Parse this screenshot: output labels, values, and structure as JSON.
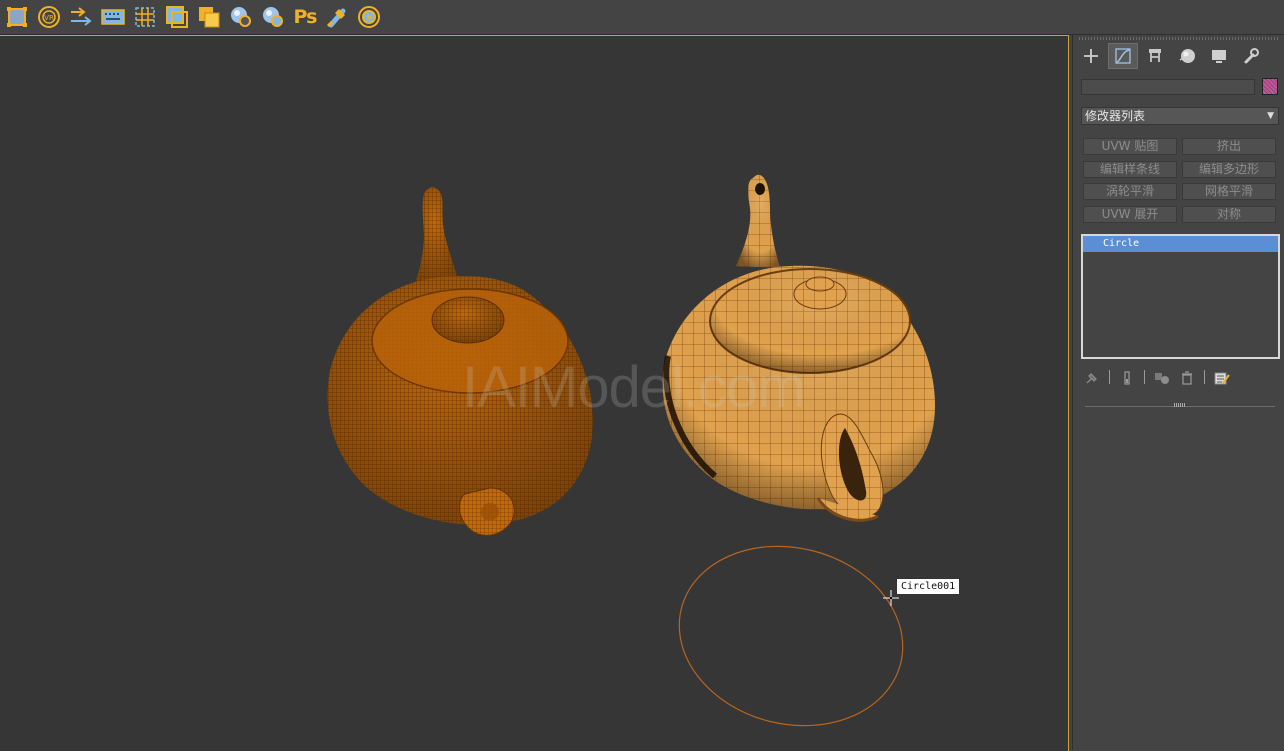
{
  "toolbar": {
    "icons": [
      "select-region-icon",
      "vray-icon",
      "link-arrows-icon",
      "keyboard-icon",
      "grid-select-icon",
      "clone-frame-icon",
      "layers-icon",
      "material-sphere-icon",
      "render-sphere-icon",
      "photoshop-icon",
      "paint-brush-icon",
      "target-icon"
    ],
    "ps_label": "Ps"
  },
  "viewport": {
    "watermark": "IAIModel.com",
    "tooltip": "Circle001",
    "colors": {
      "background": "#363636",
      "teapot": "#d98a1e",
      "circle_stroke": "#b8651f",
      "border": "#c9a23c"
    }
  },
  "panel": {
    "tabs": [
      "create-tab",
      "modify-tab",
      "hierarchy-tab",
      "motion-tab",
      "display-tab",
      "utilities-tab"
    ],
    "name_value": "",
    "swatch_color": "#c2589a",
    "modifier_list_label": "修改器列表",
    "modifier_buttons": [
      [
        "UVW 贴图",
        "挤出"
      ],
      [
        "编辑样条线",
        "编辑多边形"
      ],
      [
        "涡轮平滑",
        "网格平滑"
      ],
      [
        "UVW 展开",
        "对称"
      ]
    ],
    "stack_items": [
      "Circle"
    ],
    "selection_color": "#5a8fd6"
  }
}
